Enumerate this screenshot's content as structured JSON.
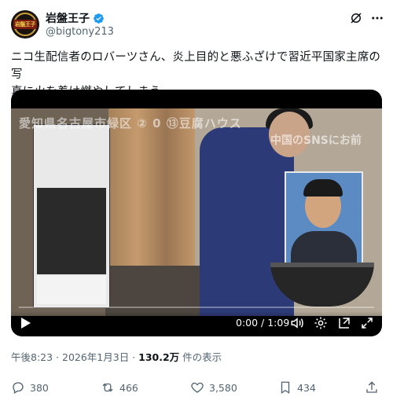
{
  "author": {
    "display_name": "岩盤王子",
    "handle": "@bigtony213",
    "avatar_text": "岩盤王子"
  },
  "tweet": {
    "text_line1": "ニコ生配信者のロバーツさん、炎上目的と悪ふざけで習近平国家主席の写",
    "text_line2": "真に火を着け燃やしてしまう。"
  },
  "video": {
    "overlay_text": "愛知県名古屋市緑区 ② 0 ⑬豆腐ハウス",
    "overlay_sub": "中国のSNSにお前",
    "time_display": "0:00 / 1:09",
    "progress": 0.0
  },
  "meta": {
    "timestamp": "午後8:23 · 2026年1月3日 · ",
    "views_count": "130.2万",
    "views_label": " 件の表示"
  },
  "actions": {
    "replies": "380",
    "reposts": "466",
    "likes": "3,580",
    "bookmarks": "434"
  },
  "colors": {
    "accent": "#1d9bf0",
    "secondary_text": "#536471",
    "primary_text": "#0f1419"
  }
}
